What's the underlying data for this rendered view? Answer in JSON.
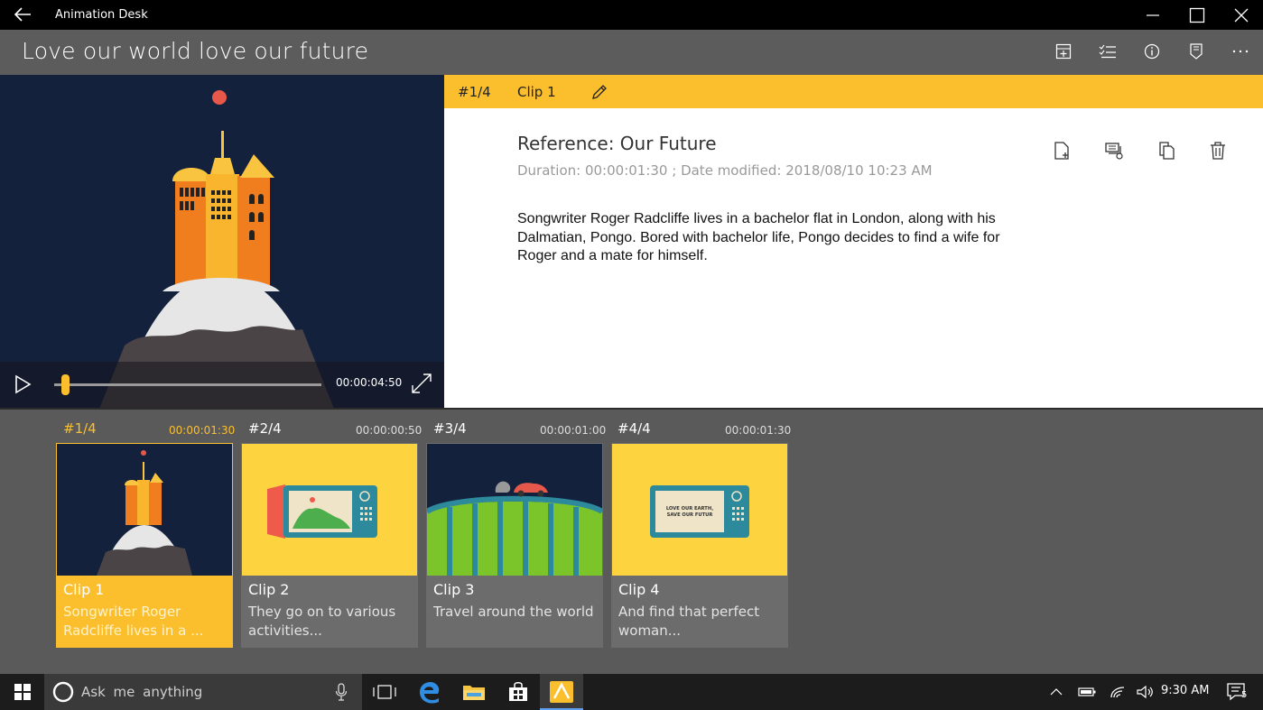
{
  "window": {
    "app_name": "Animation Desk",
    "back_icon": "back-arrow-icon",
    "controls": [
      "minimize-icon",
      "maximize-icon",
      "close-icon"
    ]
  },
  "header": {
    "title": "Love our world love our future",
    "icons": [
      "add-frame-icon",
      "checklist-icon",
      "info-icon",
      "export-icon",
      "more-icon"
    ]
  },
  "player": {
    "time": "00:00:04:50",
    "progress": 0.04
  },
  "details": {
    "clip_number": "#1/4",
    "clip_name": "Clip 1",
    "reference_title": "Reference: Our Future",
    "meta": "Duration: 00:00:01:30  ;  Date modified: 2018/08/10 10:23 AM",
    "description": "Songwriter Roger Radcliffe lives in a bachelor flat in London, along with his Dalmatian, Pongo. Bored with bachelor life, Pongo decides to find a wife for Roger and a mate for himself.",
    "actions": [
      "new-page-icon",
      "layers-icon",
      "copy-icon",
      "delete-icon"
    ]
  },
  "clips": [
    {
      "num": "#1/4",
      "duration": "00:00:01:30",
      "title": "Clip 1",
      "desc": "Songwriter Roger Radcliffe lives in a ..."
    },
    {
      "num": "#2/4",
      "duration": "00:00:00:50",
      "title": "Clip 2",
      "desc": "They go on to various activities..."
    },
    {
      "num": "#3/4",
      "duration": "00:00:01:00",
      "title": "Clip 3",
      "desc": "Travel around the world"
    },
    {
      "num": "#4/4",
      "duration": "00:00:01:30",
      "title": "Clip 4",
      "desc": "And find that perfect woman..."
    }
  ],
  "thumb4_text": "LOVE OUR EARTH, SAVE OUR FUTUR",
  "taskbar": {
    "search_placeholder": "Ask me anything",
    "time": "9:30 AM",
    "notification_count": "5"
  },
  "colors": {
    "accent": "#fbbf2e",
    "night_sky": "#14213d"
  }
}
